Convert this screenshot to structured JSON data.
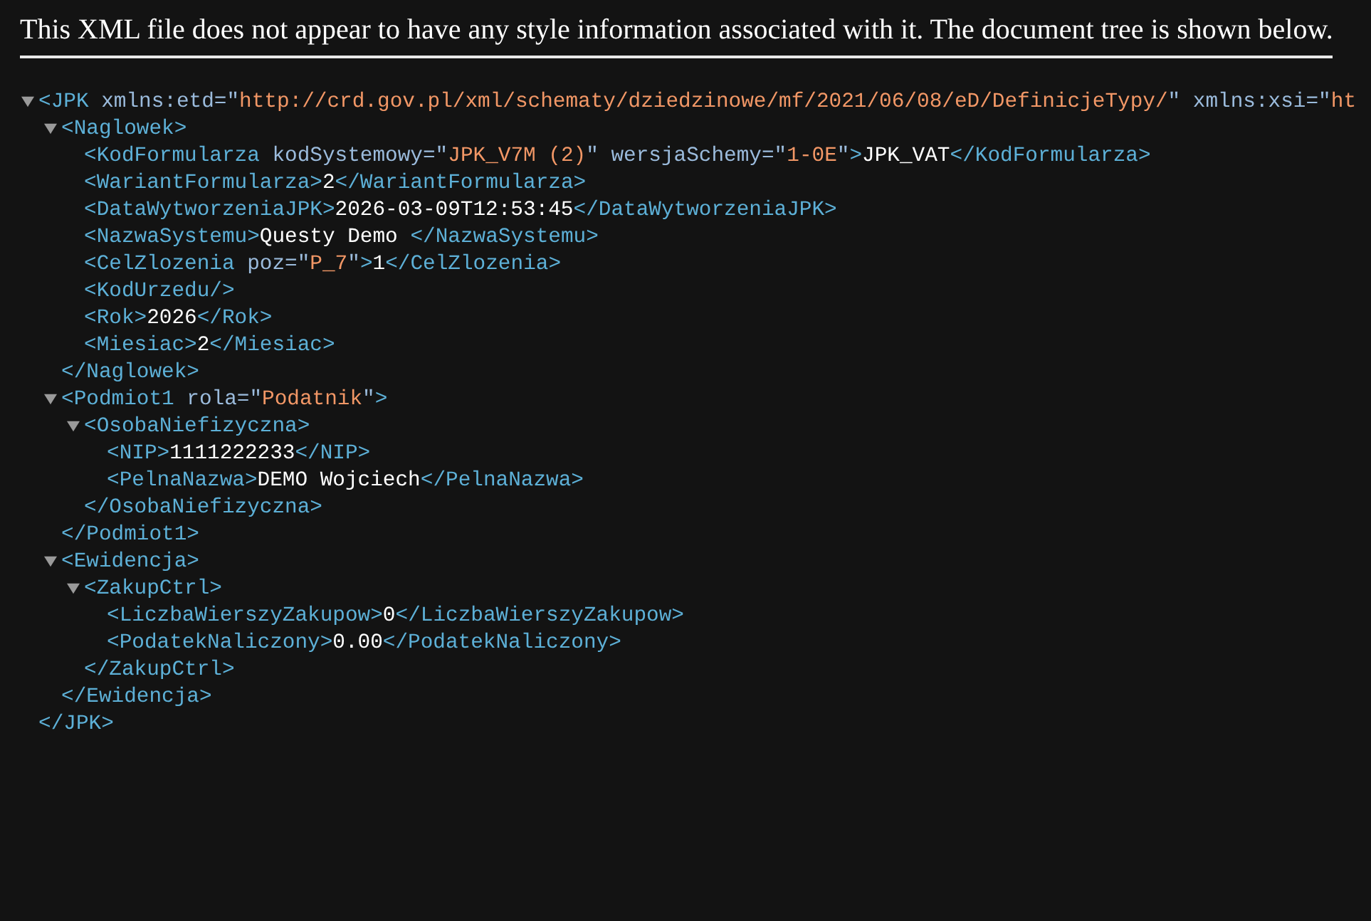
{
  "notice": "This XML file does not appear to have any style information associated with it. The document tree is shown below.",
  "tree": [
    {
      "expanded": true,
      "open": [
        {
          "kind": "tag",
          "text": "<JPK"
        },
        {
          "kind": "attr",
          "text": " xmlns:etd=\""
        },
        {
          "kind": "value",
          "text": "http://crd.gov.pl/xml/schematy/dziedzinowe/mf/2021/06/08/eD/DefinicjeTypy/"
        },
        {
          "kind": "attr",
          "text": "\" xmlns:xsi=\""
        },
        {
          "kind": "value",
          "text": "ht"
        }
      ],
      "close": "</JPK>",
      "children": [
        {
          "expanded": true,
          "open": [
            {
              "kind": "tag",
              "text": "<Naglowek>"
            }
          ],
          "close": "</Naglowek>",
          "children": [
            {
              "open": [
                {
                  "kind": "tag",
                  "text": "<KodFormularza"
                },
                {
                  "kind": "attr",
                  "text": " kodSystemowy=\""
                },
                {
                  "kind": "value",
                  "text": "JPK_V7M (2)"
                },
                {
                  "kind": "attr",
                  "text": "\" wersjaSchemy=\""
                },
                {
                  "kind": "value",
                  "text": "1-0E"
                },
                {
                  "kind": "attr",
                  "text": "\""
                },
                {
                  "kind": "tag",
                  "text": ">"
                }
              ],
              "text": "JPK_VAT",
              "close": "</KodFormularza>"
            },
            {
              "open": [
                {
                  "kind": "tag",
                  "text": "<WariantFormularza>"
                }
              ],
              "text": "2",
              "close": "</WariantFormularza>"
            },
            {
              "open": [
                {
                  "kind": "tag",
                  "text": "<DataWytworzeniaJPK>"
                }
              ],
              "text": "2026-03-09T12:53:45",
              "close": "</DataWytworzeniaJPK>"
            },
            {
              "open": [
                {
                  "kind": "tag",
                  "text": "<NazwaSystemu>"
                }
              ],
              "text": "Questy Demo ",
              "close": "</NazwaSystemu>"
            },
            {
              "open": [
                {
                  "kind": "tag",
                  "text": "<CelZlozenia"
                },
                {
                  "kind": "attr",
                  "text": " poz=\""
                },
                {
                  "kind": "value",
                  "text": "P_7"
                },
                {
                  "kind": "attr",
                  "text": "\""
                },
                {
                  "kind": "tag",
                  "text": ">"
                }
              ],
              "text": "1",
              "close": "</CelZlozenia>"
            },
            {
              "open": [
                {
                  "kind": "tag",
                  "text": "<KodUrzedu/>"
                }
              ]
            },
            {
              "open": [
                {
                  "kind": "tag",
                  "text": "<Rok>"
                }
              ],
              "text": "2026",
              "close": "</Rok>"
            },
            {
              "open": [
                {
                  "kind": "tag",
                  "text": "<Miesiac>"
                }
              ],
              "text": "2",
              "close": "</Miesiac>"
            }
          ]
        },
        {
          "expanded": true,
          "open": [
            {
              "kind": "tag",
              "text": "<Podmiot1"
            },
            {
              "kind": "attr",
              "text": " rola=\""
            },
            {
              "kind": "value",
              "text": "Podatnik"
            },
            {
              "kind": "attr",
              "text": "\""
            },
            {
              "kind": "tag",
              "text": ">"
            }
          ],
          "close": "</Podmiot1>",
          "children": [
            {
              "expanded": true,
              "open": [
                {
                  "kind": "tag",
                  "text": "<OsobaNiefizyczna>"
                }
              ],
              "close": "</OsobaNiefizyczna>",
              "children": [
                {
                  "open": [
                    {
                      "kind": "tag",
                      "text": "<NIP>"
                    }
                  ],
                  "text": "1111222233",
                  "close": "</NIP>"
                },
                {
                  "open": [
                    {
                      "kind": "tag",
                      "text": "<PelnaNazwa>"
                    }
                  ],
                  "text": "DEMO Wojciech",
                  "close": "</PelnaNazwa>"
                }
              ]
            }
          ]
        },
        {
          "expanded": true,
          "open": [
            {
              "kind": "tag",
              "text": "<Ewidencja>"
            }
          ],
          "close": "</Ewidencja>",
          "children": [
            {
              "expanded": true,
              "open": [
                {
                  "kind": "tag",
                  "text": "<ZakupCtrl>"
                }
              ],
              "close": "</ZakupCtrl>",
              "children": [
                {
                  "open": [
                    {
                      "kind": "tag",
                      "text": "<LiczbaWierszyZakupow>"
                    }
                  ],
                  "text": "0",
                  "close": "</LiczbaWierszyZakupow>"
                },
                {
                  "open": [
                    {
                      "kind": "tag",
                      "text": "<PodatekNaliczony>"
                    }
                  ],
                  "text": "0.00",
                  "close": "</PodatekNaliczony>"
                }
              ]
            }
          ]
        }
      ]
    }
  ]
}
